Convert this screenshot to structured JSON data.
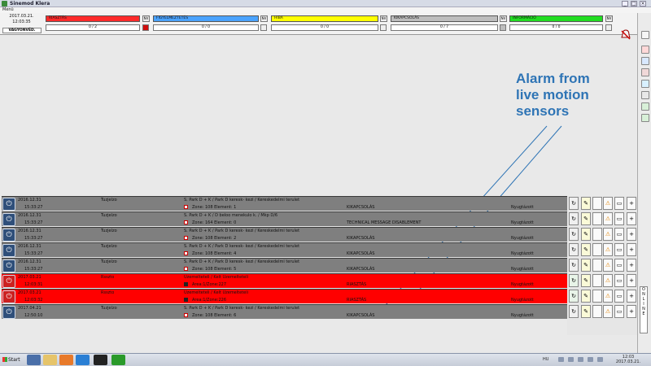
{
  "window": {
    "title": "Sinemod Klera"
  },
  "menu": {
    "label": "Menü"
  },
  "header": {
    "date": "2017.03.21.",
    "time": "12:03:35",
    "vagyonvedelem": "VAGYONVÉD."
  },
  "categories": [
    {
      "label": "RIASZTÁS",
      "nv": "NV",
      "count": "0 / 2",
      "color": "#ff2a2a",
      "sq": "#d01010"
    },
    {
      "label": "FIGYELMEZTETÉS",
      "nv": "NV",
      "count": "0 / 0",
      "color": "#4aa3ff",
      "sq": "#eeeeee"
    },
    {
      "label": "HIBA",
      "nv": "NV",
      "count": "0 / 0",
      "color": "#ffff00",
      "sq": "#eeeeee"
    },
    {
      "label": "KIKAPCSOLÁS",
      "nv": "NV",
      "count": "0 / 7",
      "color": "#bdbdbd",
      "sq": "#bdbdbd"
    },
    {
      "label": "INFORMÁCIÓ",
      "nv": "NV",
      "count": "0 / 0",
      "color": "#22dd22",
      "sq": "#eeeeee"
    }
  ],
  "rows": [
    {
      "date": "2016.12.31",
      "time": "15:33:27",
      "user": "Tuzjelzo",
      "location": "S. Park D + K / Park D keresk- kezi / Kereskedelmi terulet",
      "zone": "Zone: 108 Element: 1",
      "type": "KIKAPCSOLÁS",
      "status": "Nyugtázott",
      "color": "gray"
    },
    {
      "date": "2016.12.31",
      "time": "15:33:27",
      "user": "Tuzjelzo",
      "location": "S. Park D + K / D beloo menekulo k. / Mkp D/6",
      "zone": "Zone: 164 Element: 0",
      "type": "TECHNICAL MESSAGE DISABLEMENT",
      "status": "Nyugtázott",
      "color": "gray"
    },
    {
      "date": "2016.12.31",
      "time": "15:33:27",
      "user": "Tuzjelzo",
      "location": "S. Park D + K / Park D keresk- kezi / Kereskedelmi terulet",
      "zone": "Zone: 108 Element: 2",
      "type": "KIKAPCSOLÁS",
      "status": "Nyugtázott",
      "color": "gray"
    },
    {
      "date": "2016.12.31",
      "time": "15:33:27",
      "user": "Tuzjelzo",
      "location": "S. Park D + K / Park D keresk- kezi / Kereskedelmi terulet",
      "zone": "Zone: 108 Element: 4",
      "type": "KIKAPCSOLÁS",
      "status": "Nyugtázott",
      "color": "gray"
    },
    {
      "date": "2016.12.31",
      "time": "15:33:27",
      "user": "Tuzjelzo",
      "location": "S. Park D + K / Park D keresk- kezi / Kereskedelmi terulet",
      "zone": "Zone: 108 Element: 5",
      "type": "KIKAPCSOLÁS",
      "status": "Nyugtázott",
      "color": "gray"
    },
    {
      "date": "2017.03.21",
      "time": "12:03:31",
      "user": "Rsszto",
      "location": "Uzemelteteli / Kelt Uzemelteteli",
      "zone": "Area:1/Zone:227",
      "type": "RIASZTÁS",
      "status": "Nyugtázott",
      "color": "red"
    },
    {
      "date": "2017.03.21",
      "time": "12:03:32",
      "user": "Rsszto",
      "location": "Uzemelteteli / Kelt Uzemelteteli",
      "zone": "Area:1/Zone:226",
      "type": "RIASZTÁS",
      "status": "Nyugtázott",
      "color": "red"
    },
    {
      "date": "2017.04.21",
      "time": "12:50:10",
      "user": "Tuzjelzo",
      "location": "S. Park D + K / Park D keresk- kezi / Kereskedelmi terulet",
      "zone": "Zone: 108 Element: 6",
      "type": "KIKAPCSOLÁS",
      "status": "Nyugtázott",
      "color": "gray"
    }
  ],
  "online_strip": "ONLINE",
  "annotation": {
    "line1": "Alarm from",
    "line2": "live motion",
    "line3": "sensors",
    "color": "#2e74b5"
  },
  "taskbar": {
    "start": "Start",
    "lang": "HU",
    "clock_time": "12:03",
    "clock_date": "2017.03.21."
  }
}
